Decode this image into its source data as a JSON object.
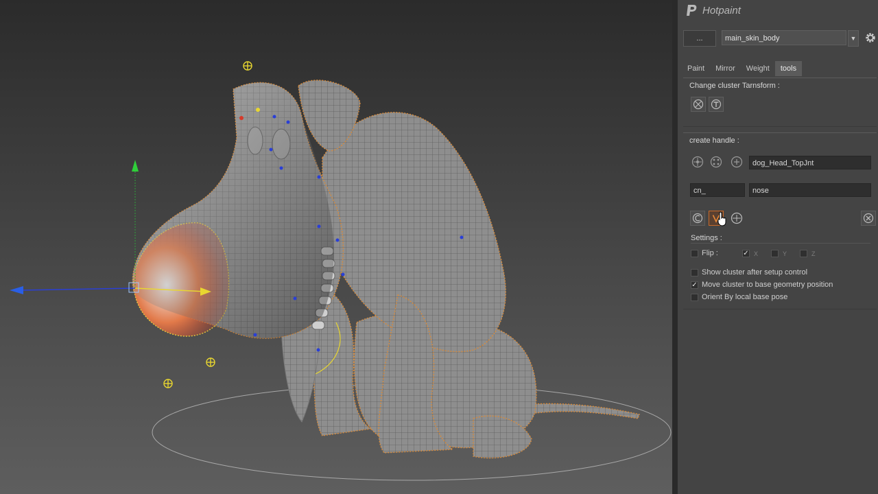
{
  "app": {
    "title": "Hotpaint"
  },
  "top_bar": {
    "dots_label": "...",
    "skin_select_value": "main_skin_body"
  },
  "tabs": [
    {
      "label": "Paint",
      "active": false
    },
    {
      "label": "Mirror",
      "active": false
    },
    {
      "label": "Weight",
      "active": false
    },
    {
      "label": "tools",
      "active": true
    }
  ],
  "cluster_transform": {
    "title": "Change cluster Tarnsform :"
  },
  "create_handle": {
    "title": "create handle :",
    "joint_field_value": "dog_Head_TopJnt",
    "prefix_field_value": "cn_",
    "name_field_value": "nose"
  },
  "settings": {
    "title": "Settings :",
    "flip_label": "Flip :",
    "flip_x_label": "X",
    "flip_y_label": "Y",
    "flip_z_label": "Z",
    "flip_x_checked": true,
    "flip_y_checked": false,
    "flip_z_checked": false,
    "options": [
      {
        "label": "Show cluster after setup control",
        "checked": false
      },
      {
        "label": "Move cluster to base geometry position",
        "checked": true
      },
      {
        "label": "Orient By local base pose",
        "checked": false
      }
    ]
  },
  "colors": {
    "panel_bg": "#444444",
    "viewport_top": "#2b2b2b",
    "viewport_bottom": "#5e5e5e",
    "wire_orange": "#d98b3a",
    "handle_yellow": "#e8d630",
    "active_tool": "#c96a2a"
  }
}
